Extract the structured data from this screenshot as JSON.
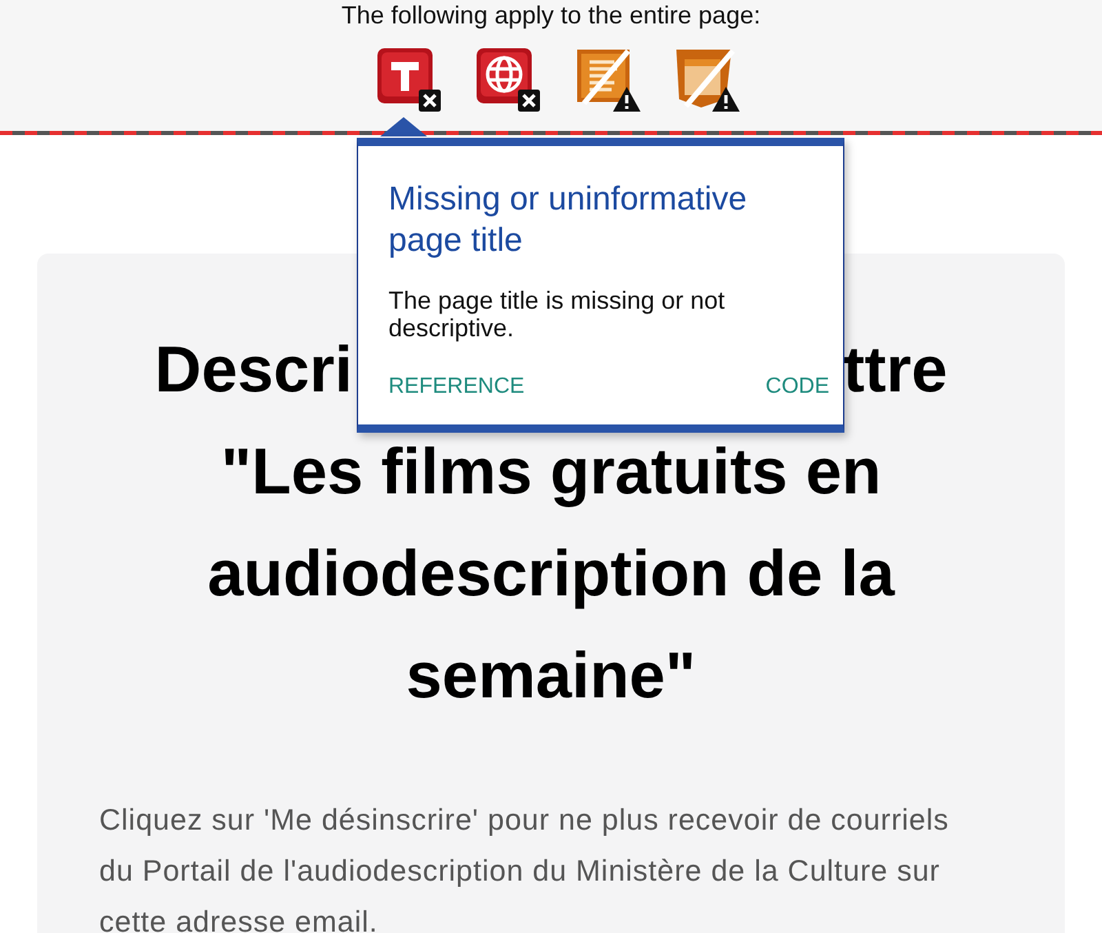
{
  "toolbar": {
    "caption": "The following apply to the entire page:",
    "icons": [
      {
        "kind": "title",
        "badge": {
          "kind": "error"
        },
        "selected": true
      },
      {
        "kind": "language",
        "badge": {
          "kind": "error"
        },
        "selected": false
      },
      {
        "kind": "text",
        "badge": {
          "kind": "alert"
        },
        "selected": false
      },
      {
        "kind": "layout",
        "badge": {
          "kind": "alert"
        },
        "selected": false
      }
    ]
  },
  "popup": {
    "title": "Missing or uninformative page title",
    "text": "The page title is missing or not descriptive.",
    "links": [
      "REFERENCE",
      "CODE"
    ]
  },
  "heading": {
    "first_line_parts": [
      "Descri",
      "ttre"
    ],
    "lines": [
      "\"Les films gratuits en",
      "audiodescription de la",
      "semaine\""
    ]
  },
  "paragraph": "Cliquez sur 'Me désinscrire' pour ne plus recevoir de courriels du Portail de l'audiodescription du Ministère de la Culture sur cette adresse email."
}
